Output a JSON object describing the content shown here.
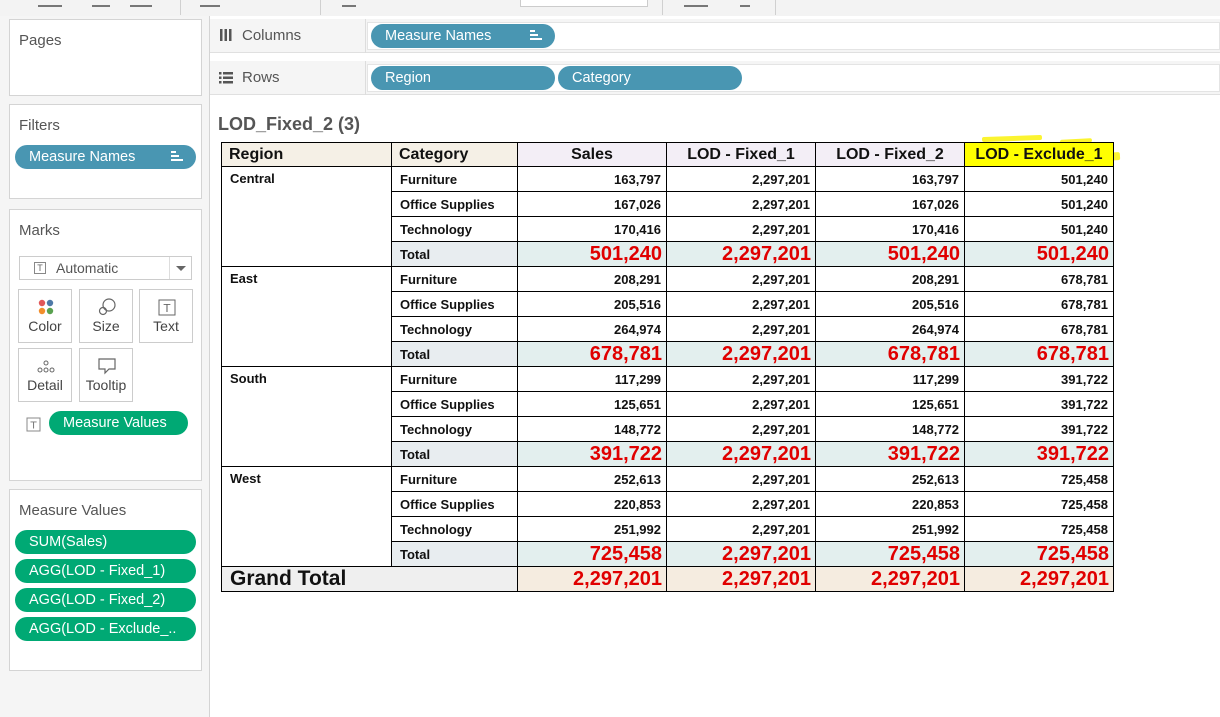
{
  "shelves": {
    "pages_label": "Pages",
    "filters_label": "Filters",
    "filters_pill": "Measure Names",
    "columns_label": "Columns",
    "columns_pill": "Measure Names",
    "rows_label": "Rows",
    "rows_pills": [
      "Region",
      "Category"
    ]
  },
  "marks": {
    "title": "Marks",
    "mark_type": "Automatic",
    "buttons": [
      "Color",
      "Size",
      "Text",
      "Detail",
      "Tooltip"
    ],
    "text_pill": "Measure Values"
  },
  "measure_values": {
    "title": "Measure Values",
    "items": [
      "SUM(Sales)",
      "AGG(LOD - Fixed_1)",
      "AGG(LOD - Fixed_2)",
      "AGG(LOD - Exclude_.."
    ]
  },
  "view": {
    "title": "LOD_Fixed_2 (3)",
    "headers": [
      "Region",
      "Category",
      "Sales",
      "LOD - Fixed_1",
      "LOD - Fixed_2",
      "LOD - Exclude_1"
    ],
    "highlighted_header": "LOD - Exclude_1",
    "colors": {
      "total_text": "#e00000",
      "highlight": "#ffff00",
      "pill_blue": "#4996b2",
      "pill_green": "#00a974"
    },
    "regions": [
      {
        "name": "Central",
        "rows": [
          {
            "category": "Furniture",
            "values": [
              "163,797",
              "2,297,201",
              "163,797",
              "501,240"
            ]
          },
          {
            "category": "Office Supplies",
            "values": [
              "167,026",
              "2,297,201",
              "167,026",
              "501,240"
            ]
          },
          {
            "category": "Technology",
            "values": [
              "170,416",
              "2,297,201",
              "170,416",
              "501,240"
            ]
          },
          {
            "category": "Total",
            "values": [
              "501,240",
              "2,297,201",
              "501,240",
              "501,240"
            ]
          }
        ]
      },
      {
        "name": "East",
        "rows": [
          {
            "category": "Furniture",
            "values": [
              "208,291",
              "2,297,201",
              "208,291",
              "678,781"
            ]
          },
          {
            "category": "Office Supplies",
            "values": [
              "205,516",
              "2,297,201",
              "205,516",
              "678,781"
            ]
          },
          {
            "category": "Technology",
            "values": [
              "264,974",
              "2,297,201",
              "264,974",
              "678,781"
            ]
          },
          {
            "category": "Total",
            "values": [
              "678,781",
              "2,297,201",
              "678,781",
              "678,781"
            ]
          }
        ]
      },
      {
        "name": "South",
        "rows": [
          {
            "category": "Furniture",
            "values": [
              "117,299",
              "2,297,201",
              "117,299",
              "391,722"
            ]
          },
          {
            "category": "Office Supplies",
            "values": [
              "125,651",
              "2,297,201",
              "125,651",
              "391,722"
            ]
          },
          {
            "category": "Technology",
            "values": [
              "148,772",
              "2,297,201",
              "148,772",
              "391,722"
            ]
          },
          {
            "category": "Total",
            "values": [
              "391,722",
              "2,297,201",
              "391,722",
              "391,722"
            ]
          }
        ]
      },
      {
        "name": "West",
        "rows": [
          {
            "category": "Furniture",
            "values": [
              "252,613",
              "2,297,201",
              "252,613",
              "725,458"
            ]
          },
          {
            "category": "Office Supplies",
            "values": [
              "220,853",
              "2,297,201",
              "220,853",
              "725,458"
            ]
          },
          {
            "category": "Technology",
            "values": [
              "251,992",
              "2,297,201",
              "251,992",
              "725,458"
            ]
          },
          {
            "category": "Total",
            "values": [
              "725,458",
              "2,297,201",
              "725,458",
              "725,458"
            ]
          }
        ]
      }
    ],
    "grand_total": {
      "label": "Grand Total",
      "values": [
        "2,297,201",
        "2,297,201",
        "2,297,201",
        "2,297,201"
      ]
    }
  }
}
